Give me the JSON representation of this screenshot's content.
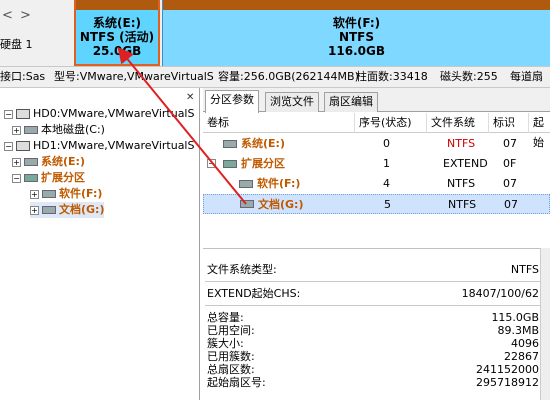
{
  "diskmap": {
    "nav_left": "<",
    "nav_right": ">",
    "disk_label": "硬盘 1",
    "partitions": [
      {
        "name": "系统(E:)",
        "fs": "NTFS (活动)",
        "size": "25.0GB"
      },
      {
        "name": "软件(F:)",
        "fs": "NTFS",
        "size": "116.0GB"
      }
    ]
  },
  "infobar": {
    "interface": "接口:Sas",
    "model": "型号:VMware,VMwareVirtualS",
    "capacity": "容量:256.0GB(262144MB)",
    "cylinders": "柱面数:33418",
    "heads": "磁头数:255",
    "sectors": "每道扇"
  },
  "tree": {
    "items": [
      {
        "label": "HD0:VMware,VMwareVirtualS",
        "type": "disk"
      },
      {
        "label": "本地磁盘(C:)",
        "type": "part"
      },
      {
        "label": "HD1:VMware,VMwareVirtualS",
        "type": "disk"
      },
      {
        "label": "系统(E:)",
        "type": "part"
      },
      {
        "label": "扩展分区",
        "type": "ext"
      },
      {
        "label": "软件(F:)",
        "type": "part"
      },
      {
        "label": "文档(G:)",
        "type": "part"
      }
    ]
  },
  "tabs": [
    "分区参数",
    "浏览文件",
    "扇区编辑"
  ],
  "table": {
    "headers": [
      "卷标",
      "序号(状态)",
      "文件系统",
      "标识",
      "起始"
    ],
    "rows": [
      {
        "label": "系统(E:)",
        "index": "0",
        "fs": "NTFS",
        "id": "07"
      },
      {
        "label": "扩展分区",
        "index": "1",
        "fs": "EXTEND",
        "id": "0F"
      },
      {
        "label": "软件(F:)",
        "index": "4",
        "fs": "NTFS",
        "id": "07"
      },
      {
        "label": "文档(G:)",
        "index": "5",
        "fs": "NTFS",
        "id": "07"
      }
    ]
  },
  "details": {
    "fs_type_label": "文件系统类型:",
    "fs_type_value": "NTFS",
    "extend_chs_label": "EXTEND起始CHS:",
    "extend_chs_value": "18407/100/62",
    "rows": [
      {
        "k": "总容量:",
        "v": "115.0GB"
      },
      {
        "k": "已用空间:",
        "v": "89.3MB"
      },
      {
        "k": "簇大小:",
        "v": "4096"
      },
      {
        "k": "已用簇数:",
        "v": "22867"
      },
      {
        "k": "总扇区数:",
        "v": "241152000"
      },
      {
        "k": "起始扇区号:",
        "v": "295718912"
      }
    ]
  },
  "colors": {
    "accent_arrow": "#e02020",
    "partition_blue": "#7fd8ff",
    "label_orange": "#c05a00"
  }
}
